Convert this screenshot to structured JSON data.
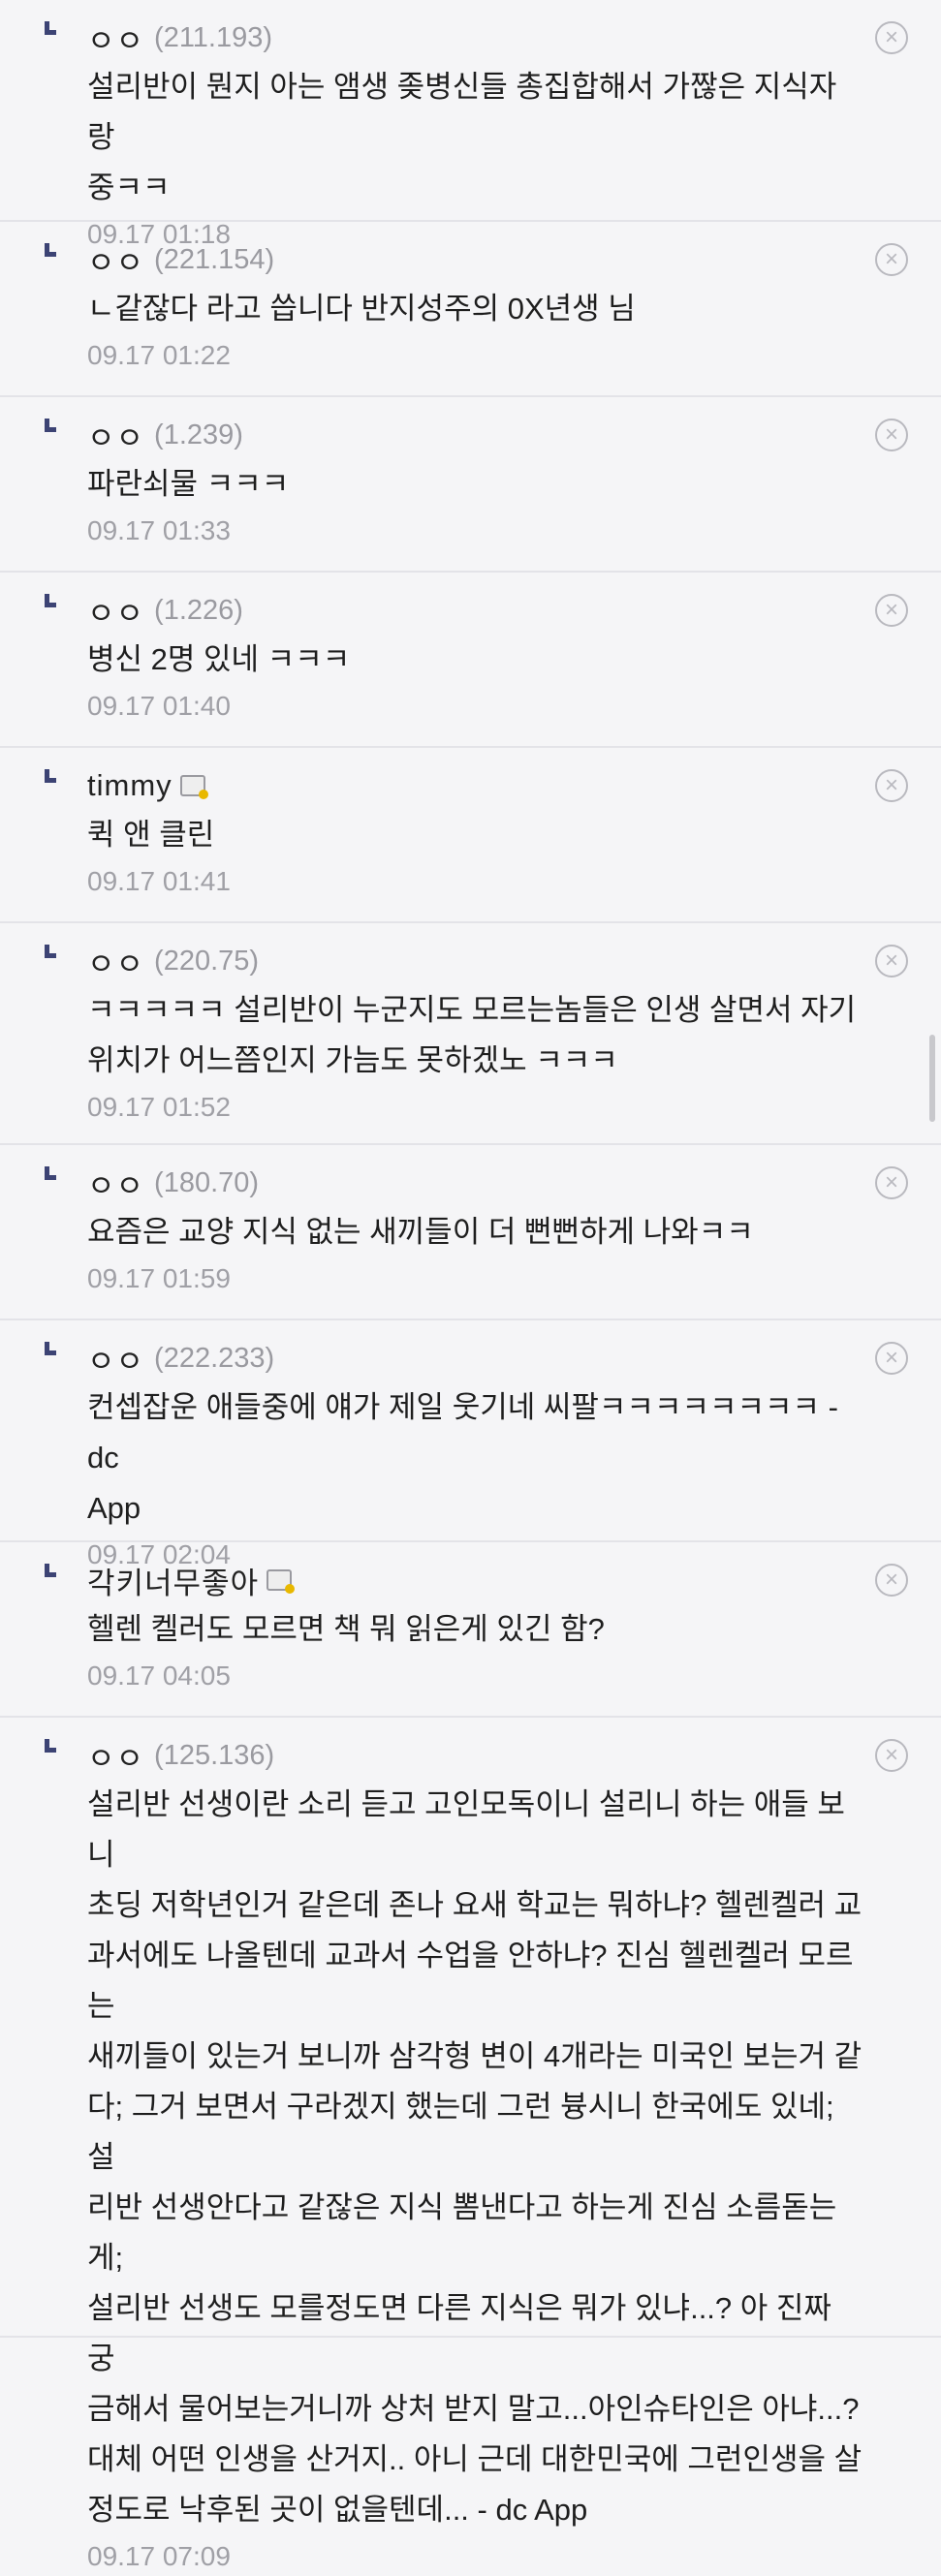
{
  "comments": [
    {
      "nick": "ㅇㅇ",
      "ip": "(211.193)",
      "text": "설리반이 뭔지 아는 앰생 좆병신들 총집합해서 가짢은 지식자랑\n중ㅋㅋ",
      "date": "09.17 01:18"
    },
    {
      "nick": "ㅇㅇ",
      "ip": "(221.154)",
      "text": "ㄴ같잖다 라고 씁니다 반지성주의 0X년생 님",
      "date": "09.17 01:22"
    },
    {
      "nick": "ㅇㅇ",
      "ip": "(1.239)",
      "text": "파란쇠물 ㅋㅋㅋ",
      "date": "09.17 01:33"
    },
    {
      "nick": "ㅇㅇ",
      "ip": "(1.226)",
      "text": "병신 2명 있네 ㅋㅋㅋ",
      "date": "09.17 01:40"
    },
    {
      "nick": "timmy",
      "ip": "",
      "text": "퀵 앤 클린",
      "date": "09.17 01:41",
      "gallog": true
    },
    {
      "nick": "ㅇㅇ",
      "ip": "(220.75)",
      "text": "ㅋㅋㅋㅋㅋ 설리반이 누군지도 모르는놈들은 인생 살면서 자기\n위치가 어느쯤인지 가늠도 못하겠노 ㅋㅋㅋ",
      "date": "09.17 01:52"
    },
    {
      "nick": "ㅇㅇ",
      "ip": "(180.70)",
      "text": "요즘은 교양 지식 없는 새끼들이 더 뻔뻔하게 나와ㅋㅋ",
      "date": "09.17 01:59"
    },
    {
      "nick": "ㅇㅇ",
      "ip": "(222.233)",
      "text": "컨셉잡운 애들중에 얘가 제일 웃기네 씨팔ㅋㅋㅋㅋㅋㅋㅋㅋ - dc\nApp",
      "date": "09.17 02:04"
    },
    {
      "nick": "각키너무좋아",
      "ip": "",
      "text": "헬렌 켈러도 모르면 책 뭐 읽은게 있긴 함?",
      "date": "09.17 04:05",
      "gallog": true
    },
    {
      "nick": "ㅇㅇ",
      "ip": "(125.136)",
      "text": "설리반 선생이란 소리 듣고 고인모독이니 설리니 하는 애들 보니\n초딩 저학년인거 같은데 존나 요새 학교는 뭐하냐? 헬렌켈러 교\n과서에도 나올텐데 교과서 수업을 안하냐? 진심 헬렌켈러 모르는\n새끼들이 있는거 보니까 삼각형 변이 4개라는 미국인 보는거 같\n다; 그거 보면서 구라겠지 했는데 그런 븅시니 한국에도 있네; 설\n리반 선생안다고 같잖은 지식 뽐낸다고 하는게 진심 소름돋는게;\n설리반 선생도 모를정도면 다른 지식은 뭐가 있냐...? 아 진짜 궁\n금해서 물어보는거니까 상처 받지 말고...아인슈타인은 아냐...?\n대체 어떤 인생을 산거지.. 아니 근데 대한민국에 그런인생을 살\n정도로 낙후된 곳이 없을텐데... - dc App",
      "date": "09.17 07:09"
    }
  ]
}
